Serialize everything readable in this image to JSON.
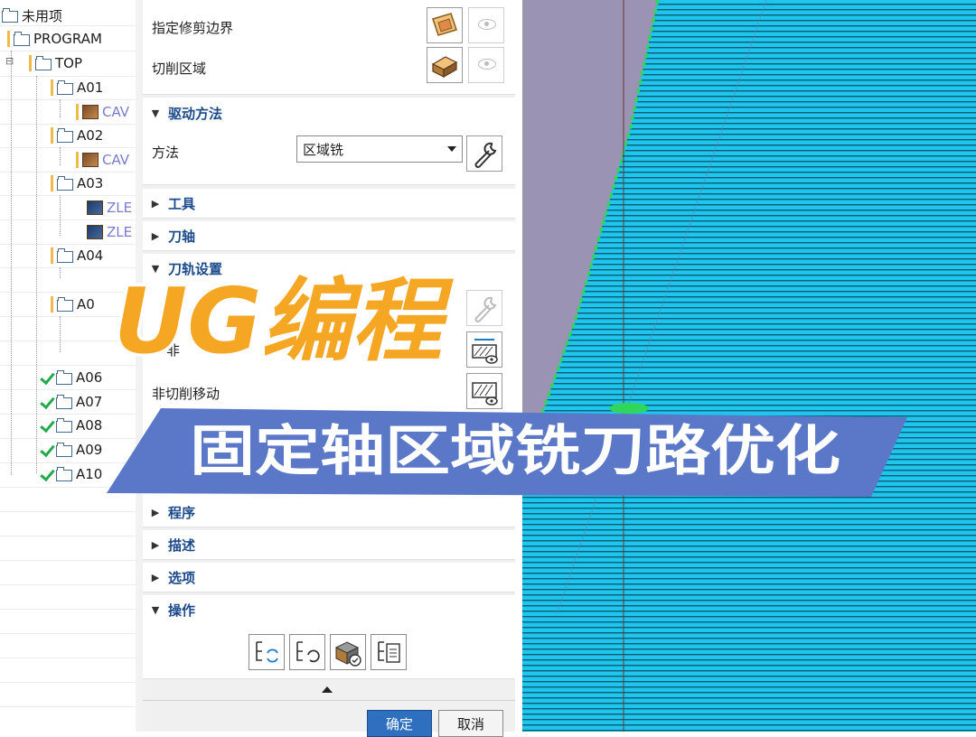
{
  "tree": {
    "nodes": [
      {
        "label": "未用项",
        "type": "folder"
      },
      {
        "label": "PROGRAM",
        "type": "folder"
      },
      {
        "label": "TOP",
        "type": "folder"
      },
      {
        "label": "A01",
        "type": "folder"
      },
      {
        "label": "CAV",
        "type": "op"
      },
      {
        "label": "A02",
        "type": "folder"
      },
      {
        "label": "CAV",
        "type": "op"
      },
      {
        "label": "A03",
        "type": "folder"
      },
      {
        "label": "ZLE",
        "type": "op"
      },
      {
        "label": "ZLE",
        "type": "op"
      },
      {
        "label": "A04",
        "type": "folder"
      },
      {
        "label": "A0",
        "type": "folder"
      },
      {
        "label": "A06",
        "type": "folder-check"
      },
      {
        "label": "A07",
        "type": "folder-check"
      },
      {
        "label": "A08",
        "type": "folder-check"
      },
      {
        "label": "A09",
        "type": "folder-check"
      },
      {
        "label": "A10",
        "type": "folder-check"
      }
    ]
  },
  "dialog": {
    "rows": {
      "trim_boundary": "指定修剪边界",
      "cut_area": "切削区域",
      "method_label": "方法",
      "method_value": "区域铣",
      "path_row_partial": "非",
      "non_cut_moves": "非切削移动"
    },
    "sections": {
      "drive_method": "驱动方法",
      "tool": "工具",
      "tool_axis": "刀轴",
      "path_settings": "刀轨设置",
      "program": "程序",
      "description": "描述",
      "options": "选项",
      "actions": "操作"
    },
    "buttons": {
      "ok": "确定",
      "cancel": "取消"
    }
  },
  "overlay": {
    "title": "UG编程",
    "subtitle": "固定轴区域铣刀路优化"
  },
  "colors": {
    "section_title": "#1a4a8a",
    "banner_orange": "#f5a623",
    "strip_blue": "#5b78c8",
    "toolpath_cyan": "#1ec6ee",
    "part_purple": "#8a82a8",
    "boundary_green": "#2fd65a",
    "check_green": "#23a84b"
  },
  "icons": {
    "trim_boundary_button": "boundary-select-icon",
    "cut_area_button": "cut-area-icon",
    "method_edit_button": "wrench-icon",
    "display_buttons": "eye-icon",
    "action_buttons": [
      "generate-icon",
      "replay-icon",
      "verify-icon",
      "list-icon"
    ]
  }
}
